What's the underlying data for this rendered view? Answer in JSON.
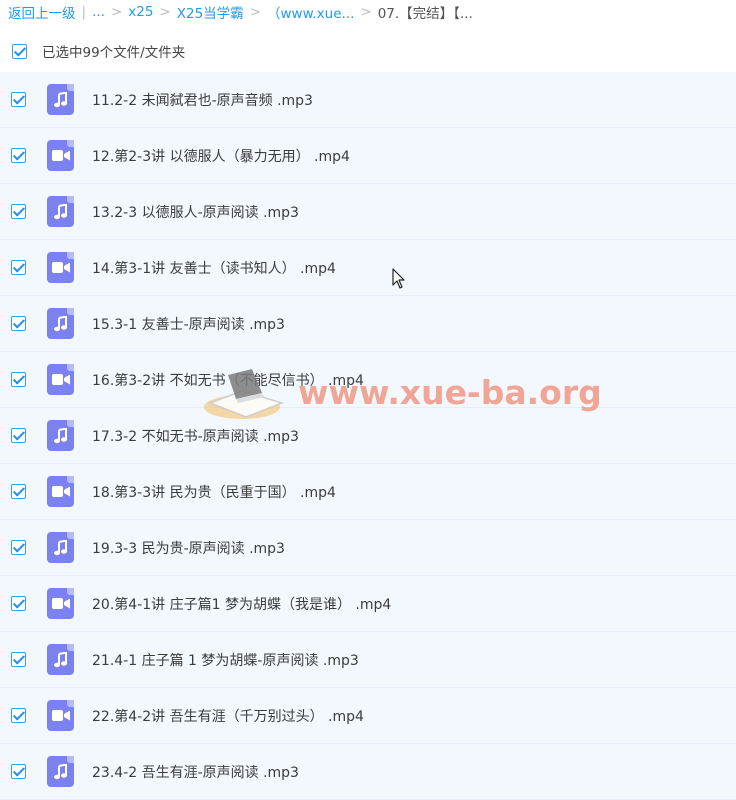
{
  "breadcrumb": {
    "back": "返回上一级",
    "divider": "|",
    "ellipsis": "...",
    "sep": ">",
    "items": [
      "x25",
      "X25当学霸",
      "（www.xue..."
    ],
    "current": "07.【完结】【..."
  },
  "selection": {
    "text": "已选中99个文件/文件夹",
    "checked": true
  },
  "files": [
    {
      "name": "11.2-2 未闻弑君也-原声音频 .mp3",
      "type": "audio",
      "icon": "music-note-icon",
      "checked": true
    },
    {
      "name": "12.第2-3讲 以德服人（暴力无用） .mp4",
      "type": "video",
      "icon": "video-camera-icon",
      "checked": true
    },
    {
      "name": "13.2-3 以德服人-原声阅读 .mp3",
      "type": "audio",
      "icon": "music-note-icon",
      "checked": true
    },
    {
      "name": "14.第3-1讲 友善士（读书知人） .mp4",
      "type": "video",
      "icon": "video-camera-icon",
      "checked": true
    },
    {
      "name": "15.3-1 友善士-原声阅读 .mp3",
      "type": "audio",
      "icon": "music-note-icon",
      "checked": true
    },
    {
      "name": "16.第3-2讲 不如无书（不能尽信书） .mp4",
      "type": "video",
      "icon": "video-camera-icon",
      "checked": true
    },
    {
      "name": "17.3-2 不如无书-原声阅读 .mp3",
      "type": "audio",
      "icon": "music-note-icon",
      "checked": true
    },
    {
      "name": "18.第3-3讲 民为贵（民重于国） .mp4",
      "type": "video",
      "icon": "video-camera-icon",
      "checked": true
    },
    {
      "name": "19.3-3 民为贵-原声阅读 .mp3",
      "type": "audio",
      "icon": "music-note-icon",
      "checked": true
    },
    {
      "name": "20.第4-1讲 庄子篇1 梦为胡蝶（我是谁） .mp4",
      "type": "video",
      "icon": "video-camera-icon",
      "checked": true
    },
    {
      "name": "21.4-1 庄子篇 1 梦为胡蝶-原声阅读 .mp3",
      "type": "audio",
      "icon": "music-note-icon",
      "checked": true
    },
    {
      "name": "22.第4-2讲 吾生有涯（千万别过头） .mp4",
      "type": "video",
      "icon": "video-camera-icon",
      "checked": true
    },
    {
      "name": "23.4-2 吾生有涯-原声阅读 .mp3",
      "type": "audio",
      "icon": "music-note-icon",
      "checked": true
    }
  ],
  "watermark": {
    "text": "www.xue-ba.org"
  },
  "colors": {
    "link": "#1f9be8",
    "row_bg": "#f2f8fe",
    "row_border": "#e5eef8",
    "icon_bg": "#7b82f0",
    "checkbox": "#1e8ef0",
    "watermark": "#f08a73"
  }
}
